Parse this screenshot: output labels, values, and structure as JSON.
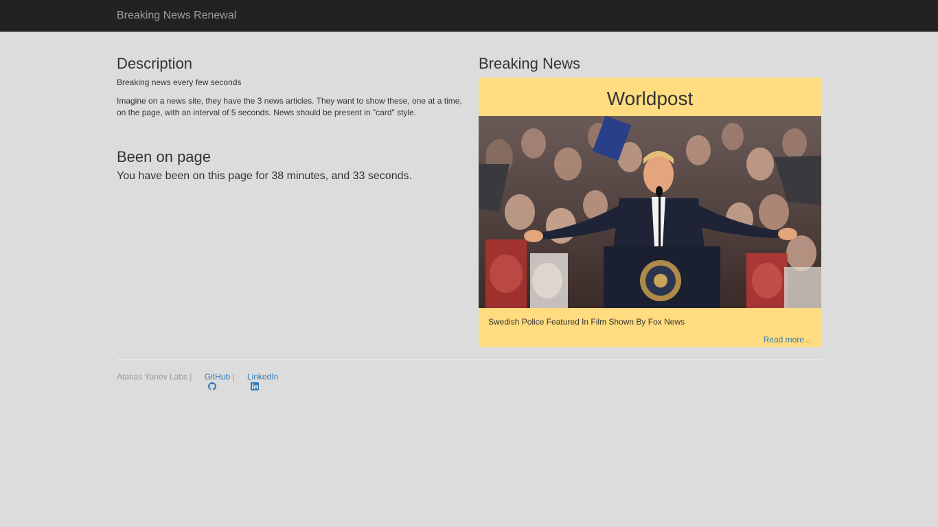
{
  "navbar": {
    "brand": "Breaking News Renewal"
  },
  "description": {
    "title": "Description",
    "subtitle": "Breaking news every few seconds",
    "body": "Imagine on a news site, they have the 3 news articles. They want to show these, one at a time, on the page, with an interval of 5 seconds. News should be present in \"card\" style."
  },
  "been_on_page": {
    "title": "Been on page",
    "text": "You have been on this page for 38 minutes, and 33 seconds."
  },
  "breaking_news": {
    "title": "Breaking News",
    "card": {
      "source": "Worldpost",
      "headline": "Swedish Police Featured In Film Shown By Fox News",
      "read_more": "Read more...",
      "background_color": "#ffdc7f"
    }
  },
  "footer": {
    "owner": "Atanas Yanev Labs",
    "separator": " | ",
    "github_label": "GitHub",
    "linkedin_label": "LinkedIn"
  },
  "colors": {
    "page_background": "#dcdcdc",
    "navbar_background": "#222222",
    "link": "#337ab7"
  }
}
